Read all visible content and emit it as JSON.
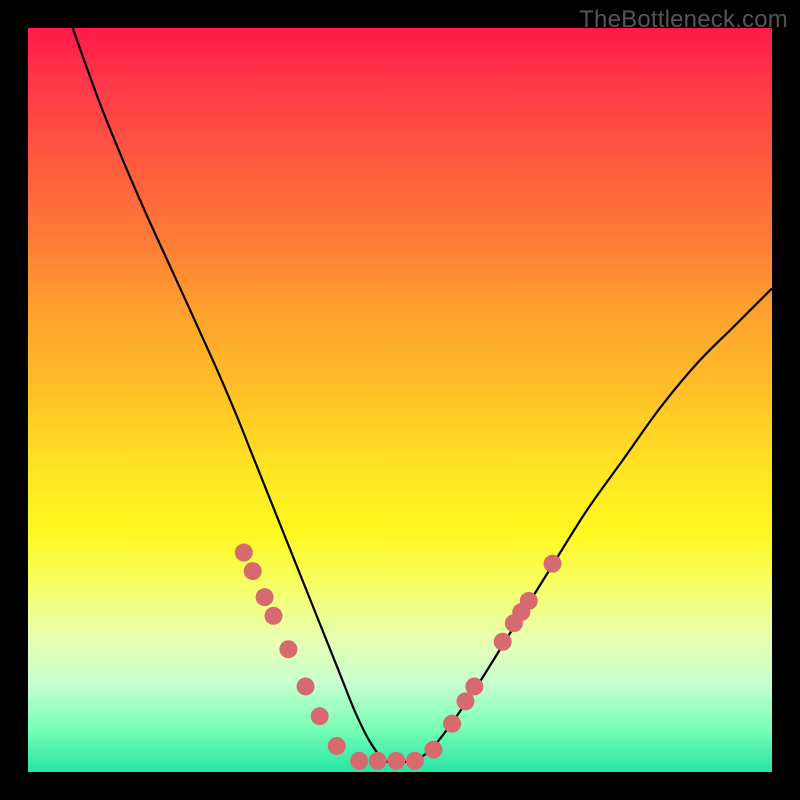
{
  "watermark": "TheBottleneck.com",
  "chart_data": {
    "type": "line",
    "title": "",
    "xlabel": "",
    "ylabel": "",
    "xlim": [
      0,
      100
    ],
    "ylim": [
      0,
      100
    ],
    "series": [
      {
        "name": "curve",
        "x": [
          6,
          10,
          15,
          20,
          25,
          28,
          30,
          32,
          34,
          36,
          38,
          40,
          42,
          44,
          46,
          48,
          50,
          52,
          55,
          60,
          65,
          70,
          75,
          80,
          85,
          90,
          95,
          100
        ],
        "y": [
          100,
          89,
          77,
          66,
          55,
          48,
          43,
          38,
          33,
          28,
          23,
          18,
          13,
          8,
          4,
          1.5,
          1.5,
          1.5,
          4,
          11,
          19,
          27,
          35,
          42,
          49,
          55,
          60,
          65
        ]
      }
    ],
    "markers": {
      "name": "dots",
      "color": "#d76a6f",
      "radius": 9,
      "points": [
        {
          "x": 29.0,
          "y": 29.5
        },
        {
          "x": 30.2,
          "y": 27.0
        },
        {
          "x": 31.8,
          "y": 23.5
        },
        {
          "x": 33.0,
          "y": 21.0
        },
        {
          "x": 35.0,
          "y": 16.5
        },
        {
          "x": 37.3,
          "y": 11.5
        },
        {
          "x": 39.2,
          "y": 7.5
        },
        {
          "x": 41.5,
          "y": 3.5
        },
        {
          "x": 44.5,
          "y": 1.5
        },
        {
          "x": 47.0,
          "y": 1.5
        },
        {
          "x": 49.5,
          "y": 1.5
        },
        {
          "x": 52.0,
          "y": 1.5
        },
        {
          "x": 54.5,
          "y": 3.0
        },
        {
          "x": 57.0,
          "y": 6.5
        },
        {
          "x": 58.8,
          "y": 9.5
        },
        {
          "x": 60.0,
          "y": 11.5
        },
        {
          "x": 63.8,
          "y": 17.5
        },
        {
          "x": 65.3,
          "y": 20.0
        },
        {
          "x": 66.3,
          "y": 21.5
        },
        {
          "x": 67.3,
          "y": 23.0
        },
        {
          "x": 70.5,
          "y": 28.0
        }
      ]
    }
  }
}
